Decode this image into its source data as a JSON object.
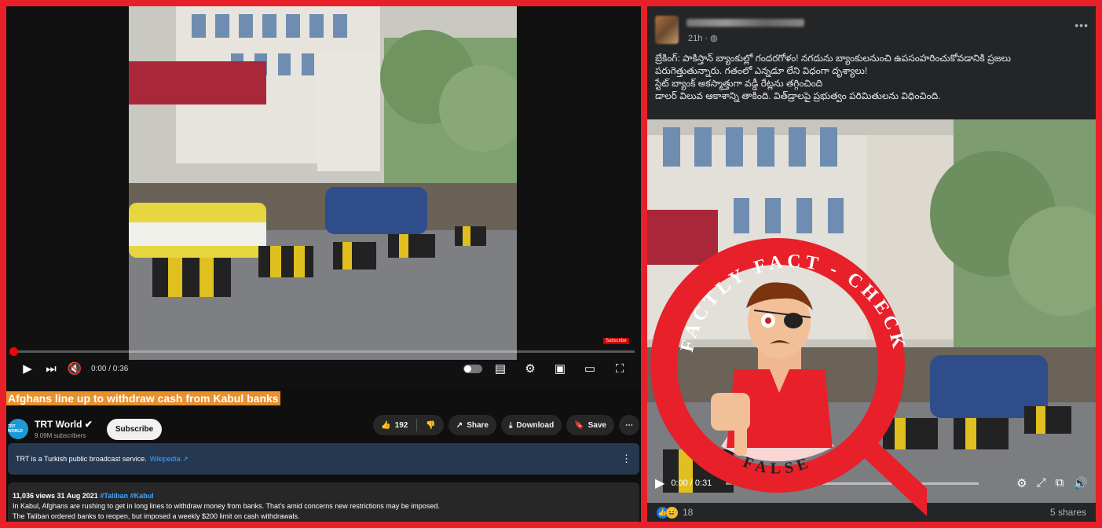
{
  "youtube": {
    "video": {
      "time": "0:00 / 0:36",
      "watermark": "Subscribe"
    },
    "title": "Afghans line up to withdraw cash from Kabul banks",
    "channel": {
      "name": "TRT World",
      "verified_icon": "check-circle-icon",
      "subscribers": "9.09M subscribers",
      "avatar_text": "TRT WORLD"
    },
    "subscribe_label": "Subscribe",
    "actions": {
      "likes": "192",
      "share": "Share",
      "download": "Download",
      "save": "Save"
    },
    "info": {
      "text": "TRT is a Turkish public broadcast service.",
      "link": "Wikipedia"
    },
    "description": {
      "stats": "11,036 views  31 Aug 2021",
      "hashtags": "#Taliban #Kabul",
      "line1": "In Kabul, Afghans are rushing to get in long lines to withdraw money from banks. That's amid concerns new restrictions may be imposed.",
      "line2": "The Taliban ordered banks to reopen, but imposed a weekly $200 limit on cash withdrawals."
    }
  },
  "facebook": {
    "time": "21h · ",
    "post_lines": [
      "బ్రేకింగ్: పాకిస్తాన్ బ్యాంకుల్లో గందరగోళం!  నగదును బ్యాంకులనుంచి ఉపసంహరించుకోవడానికి ప్రజలు",
      "పరుగెత్తుతున్నారు. గతంలో ఎన్నడూ లేని విధంగా దృశ్యాలు!",
      "స్టేట్ బ్యాంక్ అకస్మాత్తుగా వడ్డీ రేట్లను తగ్గించింది",
      "డాలర్ విలువ ఆకాశాన్ని తాకింది. విత్‌డ్రాలపై ప్రభుత్వం పరిమితులను విధించింది."
    ],
    "video_time": "0:00 / 0:31",
    "reactions_count": "18",
    "shares": "5 shares"
  },
  "badge": {
    "top_text": "FACTLY FACT - CHECK",
    "bottom_text": "FALSE"
  },
  "colors": {
    "frame_red": "#e8202a",
    "title_highlight": "#e8902c",
    "youtube_bg": "#0f0f0f",
    "facebook_bg": "#242526",
    "link_blue": "#3ea6ff"
  }
}
